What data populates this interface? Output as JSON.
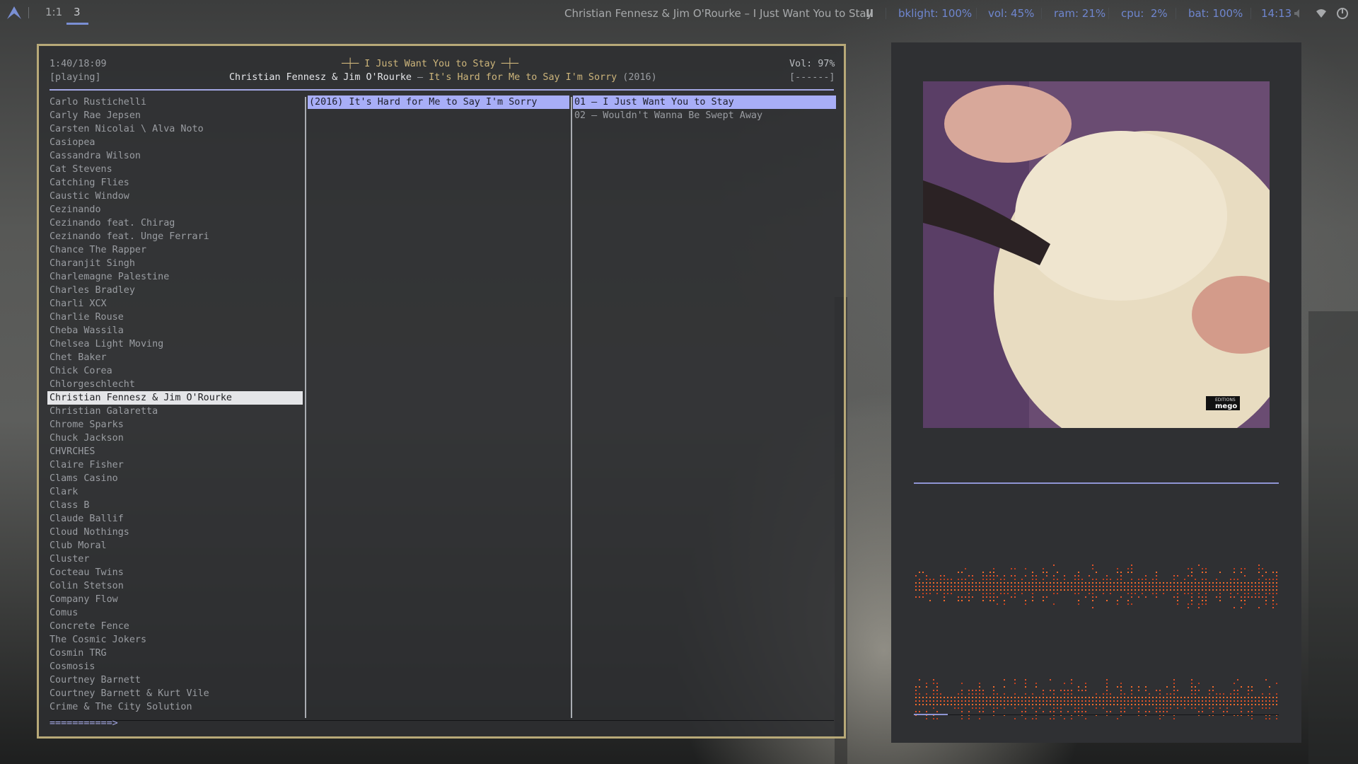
{
  "topbar": {
    "workspaces": [
      {
        "label": "1:1",
        "active": false
      },
      {
        "label": "3",
        "active": true
      }
    ],
    "now_playing": "Christian Fennesz & Jim O'Rourke – I Just Want You to Stay",
    "pause_glyph": "II",
    "bklight": "bklight: 100%",
    "vol": "vol: 45%",
    "ram": "ram: 21%",
    "cpu": "cpu:  2%",
    "bat": "bat: 100%",
    "time": "14:13",
    "icons": [
      "arch-logo-icon",
      "speaker-icon",
      "wifi-icon",
      "power-icon"
    ],
    "accent": "#7a8fd4"
  },
  "player": {
    "elapsed": "1:40/18:09",
    "state": "[playing]",
    "title_line": "─┼─ I Just Want You to Stay ─┼─",
    "artist": "Christian Fennesz & Jim O'Rourke",
    "dash": " – ",
    "album": "It's Hard for Me to Say I'm Sorry",
    "year": " (2016)",
    "volume": "Vol: 97%",
    "flags": "[------]",
    "progress_text": "===========>",
    "progress_fraction": 0.092
  },
  "artists": [
    "Carlo Rustichelli",
    "Carly Rae Jepsen",
    "Carsten Nicolai \\ Alva Noto",
    "Casiopea",
    "Cassandra Wilson",
    "Cat Stevens",
    "Catching Flies",
    "Caustic Window",
    "Cezinando",
    "Cezinando feat. Chirag",
    "Cezinando feat. Unge Ferrari",
    "Chance The Rapper",
    "Charanjit Singh",
    "Charlemagne Palestine",
    "Charles Bradley",
    "Charli XCX",
    "Charlie Rouse",
    "Cheba Wassila",
    "Chelsea Light Moving",
    "Chet Baker",
    "Chick Corea",
    "Chlorgeschlecht",
    "Christian Fennesz & Jim O'Rourke",
    "Christian Galaretta",
    "Chrome Sparks",
    "Chuck Jackson",
    "CHVRCHES",
    "Claire Fisher",
    "Clams Casino",
    "Clark",
    "Class B",
    "Claude Ballif",
    "Cloud Nothings",
    "Club Moral",
    "Cluster",
    "Cocteau Twins",
    "Colin Stetson",
    "Company Flow",
    "Comus",
    "Concrete Fence",
    "The Cosmic Jokers",
    "Cosmin TRG",
    "Cosmosis",
    "Courtney Barnett",
    "Courtney Barnett & Kurt Vile",
    "Crime & The City Solution"
  ],
  "selected_artist_index": 22,
  "albums": [
    "(2016) It's Hard for Me to Say I'm Sorry"
  ],
  "tracks": [
    "01 – I Just Want You to Stay",
    "02 – Wouldn't Wanna Be Swept Away"
  ],
  "cover": {
    "label_small": "EDITIONS",
    "label_brand": "mego"
  },
  "visualizer": {
    "colors": [
      "#e0532a",
      "#f06a2c",
      "#c0401f"
    ]
  }
}
